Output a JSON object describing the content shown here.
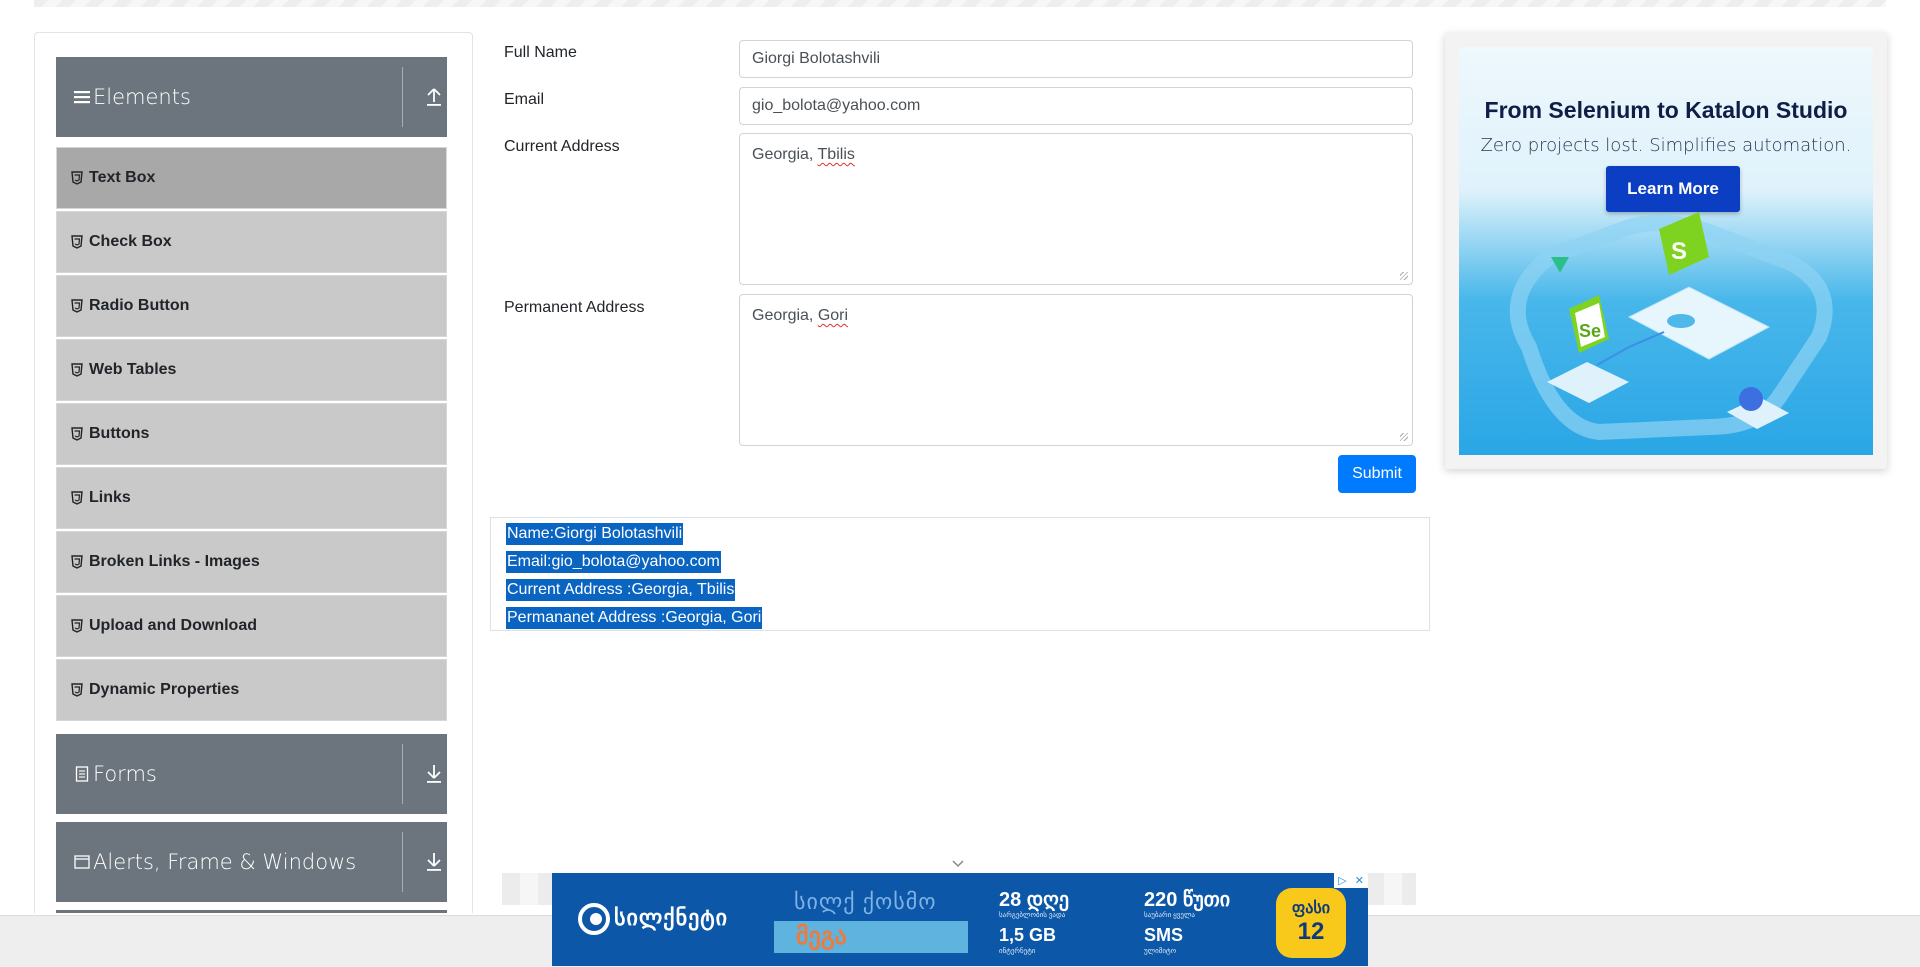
{
  "sidebar": {
    "groups": [
      {
        "title": "Elements",
        "icon": "hamburger-icon",
        "arrow": "collapse-up-icon"
      },
      {
        "title": "Forms",
        "icon": "document-icon",
        "arrow": "expand-down-icon"
      },
      {
        "title": "Alerts, Frame & Windows",
        "icon": "window-icon",
        "arrow": "expand-down-icon"
      }
    ],
    "items": [
      {
        "label": "Text Box",
        "active": true
      },
      {
        "label": "Check Box"
      },
      {
        "label": "Radio Button"
      },
      {
        "label": "Web Tables"
      },
      {
        "label": "Buttons"
      },
      {
        "label": "Links"
      },
      {
        "label": "Broken Links - Images"
      },
      {
        "label": "Upload and Download"
      },
      {
        "label": "Dynamic Properties"
      }
    ]
  },
  "form": {
    "full_name_label": "Full Name",
    "full_name_value": "Giorgi Bolotashvili",
    "email_label": "Email",
    "email_value": "gio_bolota@yahoo.com",
    "current_address_label": "Current Address",
    "current_address_prefix": "Georgia, ",
    "current_address_misspelled": "Tbilis",
    "permanent_address_label": "Permanent Address",
    "permanent_address_prefix": "Georgia, ",
    "permanent_address_misspelled": "Gori",
    "submit_label": "Submit"
  },
  "output": {
    "name": "Name:Giorgi Bolotashvili",
    "email": "Email:gio_bolota@yahoo.com",
    "current_address": "Current Address :Georgia, Tbilis",
    "permanent_address": "Permananet Address :Georgia, Gori"
  },
  "ad_right": {
    "title": "From Selenium to Katalon Studio",
    "subtitle": "Zero projects lost. Simplifies automation.",
    "button": "Learn More"
  },
  "ad_bottom": {
    "brand": "სილქნეტი",
    "slogan": "სილქ ქოსმო",
    "mega": "მეგა",
    "stat1_value": "28 დღე",
    "stat1_caption": "სარგებლობის ვადა",
    "stat2_value": "220 წუთი",
    "stat2_caption": "საუბარი ყველა",
    "stat3_value": "1,5 GB",
    "stat3_caption": "ინტერნეტი",
    "stat4_value": "SMS",
    "stat4_caption": "ულიმიტო",
    "price_label": "ფასი",
    "price_value": "12"
  },
  "colors": {
    "sidebar_header": "#6c757d",
    "menu_item": "#c9c9c9",
    "menu_item_active": "#a8a8a8",
    "submit": "#007bff",
    "selection": "#0a64c2"
  }
}
